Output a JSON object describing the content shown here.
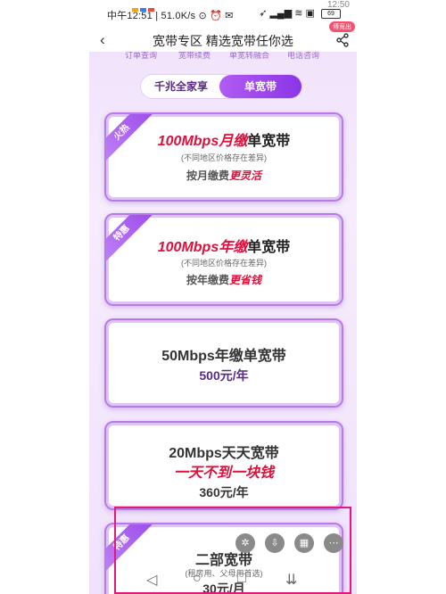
{
  "status": {
    "time": "中午12:51",
    "speed": "51.0K/s",
    "battery": "69",
    "top_time": "12:50"
  },
  "header": {
    "title": "宽带专区 精选宽带任你选",
    "back": "‹",
    "badge": "傅竞出"
  },
  "subnav": [
    "订单查询",
    "宽带续费",
    "单宽转融合",
    "电话咨询"
  ],
  "segment": {
    "option1": "千兆全家享",
    "option2": "单宽带"
  },
  "cards": [
    {
      "ribbon": "火热",
      "title_hl": "100Mbps月缴",
      "title_rest": "单宽带",
      "note": "(不同地区价格存在差异)",
      "sub_pre": "按月缴费",
      "sub_hl": "更灵活"
    },
    {
      "ribbon": "特惠",
      "title_hl": "100Mbps年缴",
      "title_rest": "单宽带",
      "note": "(不同地区价格存在差异)",
      "sub_pre": "按年缴费",
      "sub_hl": "更省钱"
    },
    {
      "title": "50Mbps年缴单宽带",
      "price": "500元/年"
    },
    {
      "title": "20Mbps天天宽带",
      "slogan": "一天不到一块钱",
      "price": "360元/年"
    },
    {
      "ribbon": "特惠",
      "title": "二部宽带",
      "note": "(租房用、父母用首选)",
      "price": "30元/月"
    }
  ],
  "nav": {
    "back": "◁",
    "home": "○",
    "recent": "□",
    "down": "⇊"
  },
  "colors": {
    "accent": "#8b34e6",
    "highlight_red": "#e0103c",
    "box": "#e2197a"
  }
}
